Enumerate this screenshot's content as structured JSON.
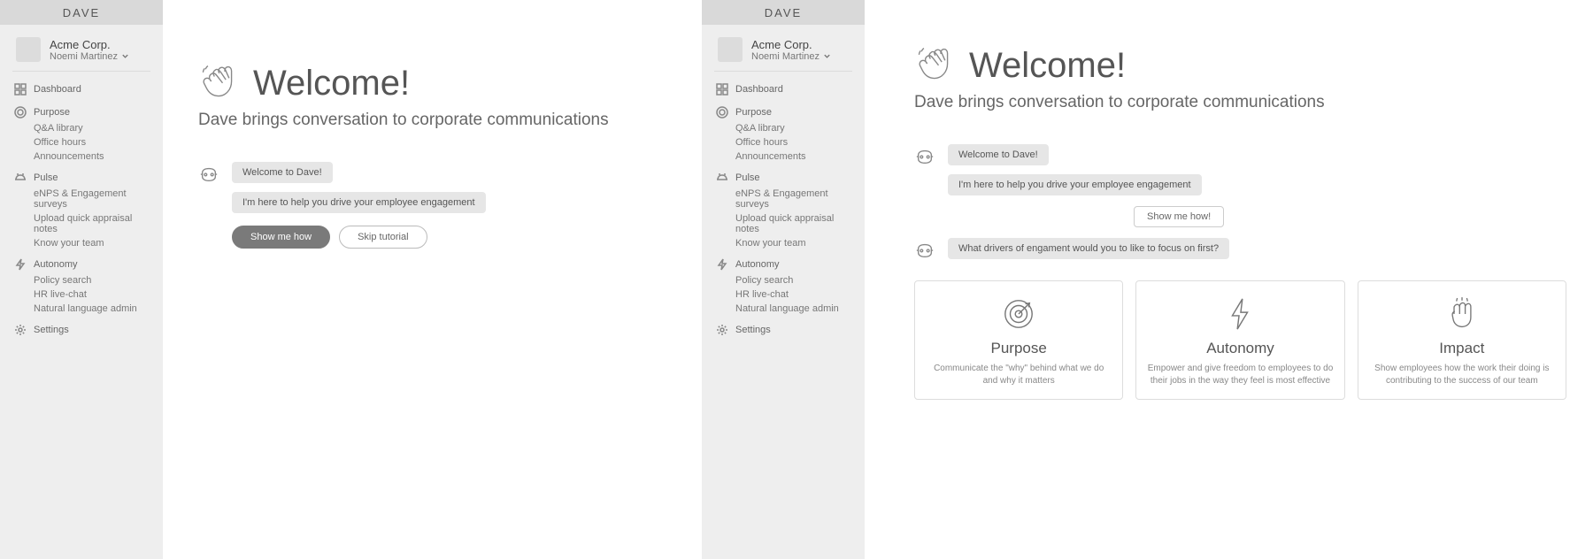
{
  "brand": "DAVE",
  "org": {
    "name": "Acme Corp.",
    "user": "Noemi Martinez"
  },
  "nav": {
    "dashboard": "Dashboard",
    "purpose": {
      "label": "Purpose",
      "qa": "Q&A library",
      "office": "Office hours",
      "ann": "Announcements"
    },
    "pulse": {
      "label": "Pulse",
      "enps": "eNPS & Engagement surveys",
      "upload": "Upload quick appraisal notes",
      "know": "Know your team"
    },
    "autonomy": {
      "label": "Autonomy",
      "policy": "Policy search",
      "hr": "HR live-chat",
      "nlp": "Natural language admin"
    },
    "settings": "Settings"
  },
  "hero": {
    "title": "Welcome!",
    "subtitle": "Dave brings conversation to corporate communications"
  },
  "left_chat": {
    "msg1": "Welcome to Dave!",
    "msg2": "I'm here to help you drive your employee engagement",
    "cta_primary": "Show me how",
    "cta_secondary": "Skip tutorial"
  },
  "right_chat": {
    "msg1": "Welcome to Dave!",
    "msg2": "I'm here to help you drive your employee engagement",
    "user_reply": "Show me how!",
    "msg3": "What drivers of engament would you to like to focus on first?"
  },
  "cards": {
    "purpose": {
      "title": "Purpose",
      "desc": "Communicate the \"why\" behind what we do and why it matters"
    },
    "autonomy": {
      "title": "Autonomy",
      "desc": "Empower and give freedom to employees to do their jobs in the way they feel is most effective"
    },
    "impact": {
      "title": "Impact",
      "desc": "Show employees how the work their doing is contributing to the success of our team"
    }
  }
}
